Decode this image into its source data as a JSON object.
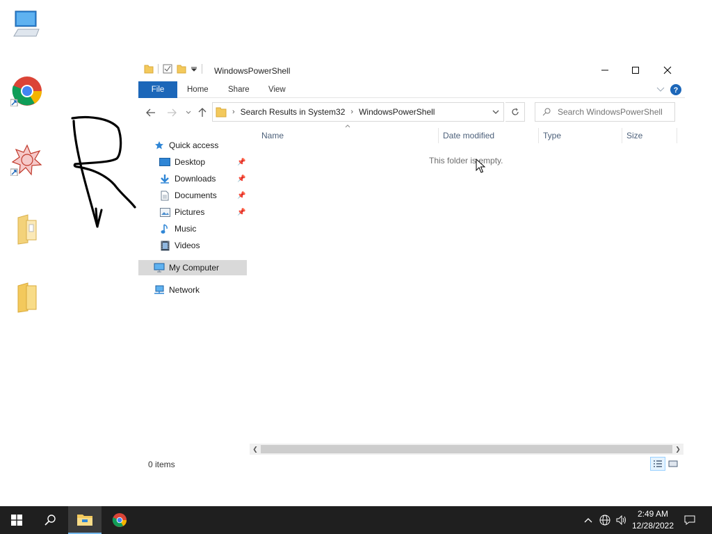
{
  "desktop": {
    "icons": [
      "this-pc-icon",
      "chrome-shortcut-icon",
      "app-shortcut-icon",
      "folder-icon",
      "folder-icon"
    ]
  },
  "window": {
    "title": "WindowsPowerShell",
    "ribbon_tabs": [
      "File",
      "Home",
      "Share",
      "View"
    ],
    "address": {
      "crumbs": [
        "Search Results in System32",
        "WindowsPowerShell"
      ]
    },
    "search": {
      "placeholder": "Search WindowsPowerShell"
    },
    "nav_pane": {
      "quick_access": "Quick access",
      "items": [
        {
          "label": "Desktop",
          "icon": "desktop-icon",
          "pinned": true
        },
        {
          "label": "Downloads",
          "icon": "download-icon",
          "pinned": true
        },
        {
          "label": "Documents",
          "icon": "documents-icon",
          "pinned": true
        },
        {
          "label": "Pictures",
          "icon": "pictures-icon",
          "pinned": true
        },
        {
          "label": "Music",
          "icon": "music-icon",
          "pinned": false
        },
        {
          "label": "Videos",
          "icon": "videos-icon",
          "pinned": false
        }
      ],
      "my_computer": "My Computer",
      "network": "Network"
    },
    "columns": [
      "Name",
      "Date modified",
      "Type",
      "Size"
    ],
    "empty_message": "This folder is empty.",
    "status": "0 items"
  },
  "taskbar": {
    "time": "2:49 AM",
    "date": "12/28/2022"
  },
  "colors": {
    "file_tab": "#1c67b9",
    "taskbar": "#1f1f1f",
    "selection": "#d9d9d9"
  }
}
